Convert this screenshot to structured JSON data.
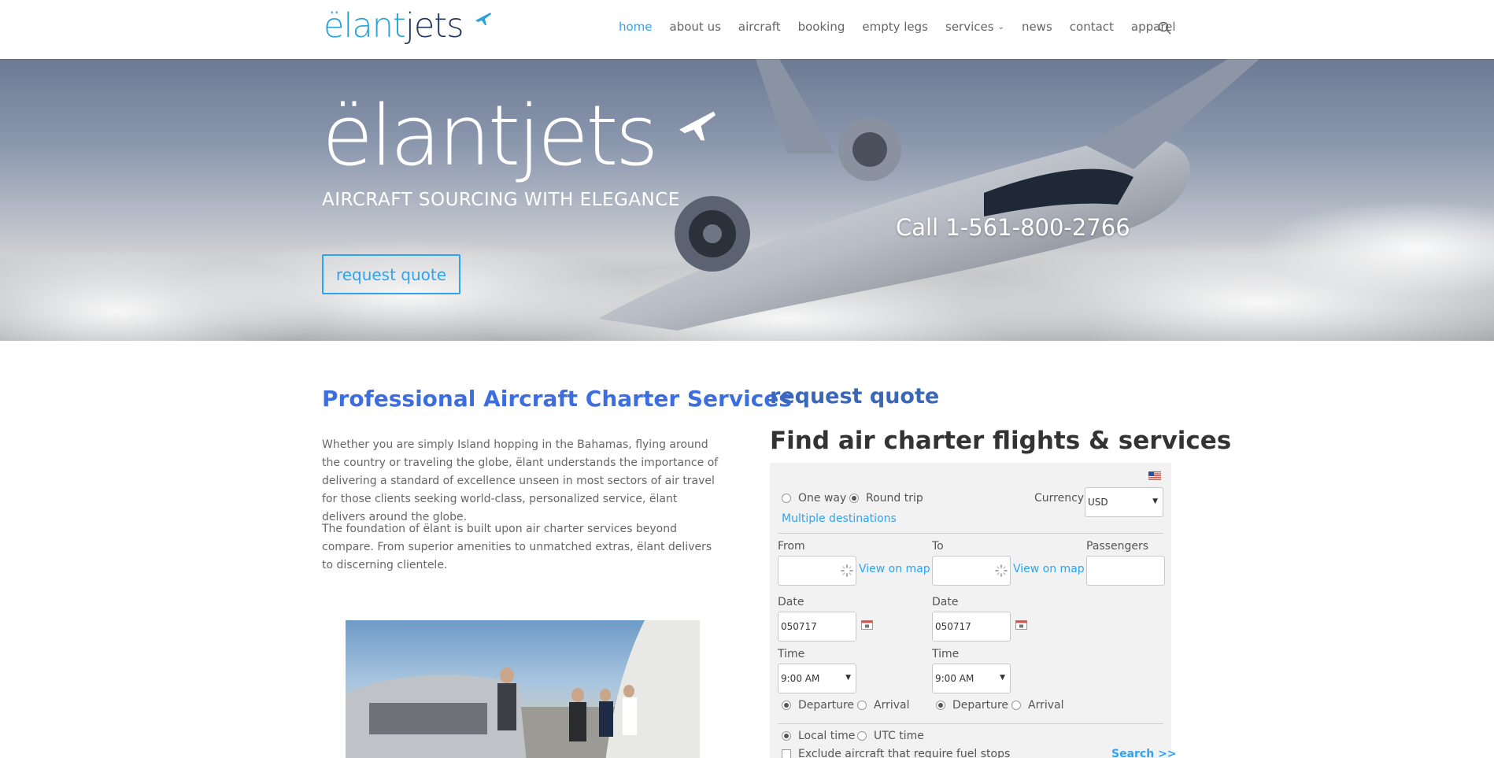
{
  "header": {
    "logo_a": "ëlant",
    "logo_b": "jets",
    "nav": [
      {
        "label": "home",
        "active": true
      },
      {
        "label": "about us"
      },
      {
        "label": "aircraft"
      },
      {
        "label": "booking"
      },
      {
        "label": "empty legs"
      },
      {
        "label": "services",
        "has_dropdown": true
      },
      {
        "label": "news"
      },
      {
        "label": "contact"
      },
      {
        "label": "apparel"
      }
    ],
    "search_icon": "search-icon"
  },
  "hero": {
    "logo_a": "ëlant",
    "logo_b": "jets",
    "tagline": "AIRCRAFT SOURCING WITH ELEGANCE",
    "call": "Call 1-561-800-2766",
    "cta": "request quote"
  },
  "main": {
    "title": "Professional Aircraft Charter Services",
    "para1": "Whether you are simply Island hopping in the Bahamas, flying around the country or traveling the globe, ëlant understands the importance of delivering a standard of excellence unseen in most sectors of air travel for those clients seeking world-class, personalized service, ëlant delivers around the globe.",
    "para2": "The foundation of ëlant is built upon air charter services beyond compare. From superior amenities to unmatched extras, ëlant delivers to discerning clientele."
  },
  "quote": {
    "heading": "request quote",
    "subheading": "Find air charter flights & services",
    "trip_one_way": "One way",
    "trip_round": "Round trip",
    "trip_selected": "Round trip",
    "multi": "Multiple destinations",
    "currency_label": "Currency",
    "currency_value": "USD",
    "from_label": "From",
    "to_label": "To",
    "passengers_label": "Passengers",
    "view_on_map": "View on map",
    "date_label": "Date",
    "from_date": "050717",
    "to_date": "050717",
    "time_label": "Time",
    "from_time": "9:00 AM",
    "to_time": "9:00 AM",
    "departure": "Departure",
    "arrival": "Arrival",
    "local_time": "Local time",
    "utc_time": "UTC time",
    "exclude_fuel": "Exclude aircraft that require fuel stops",
    "search": "Search >>"
  }
}
